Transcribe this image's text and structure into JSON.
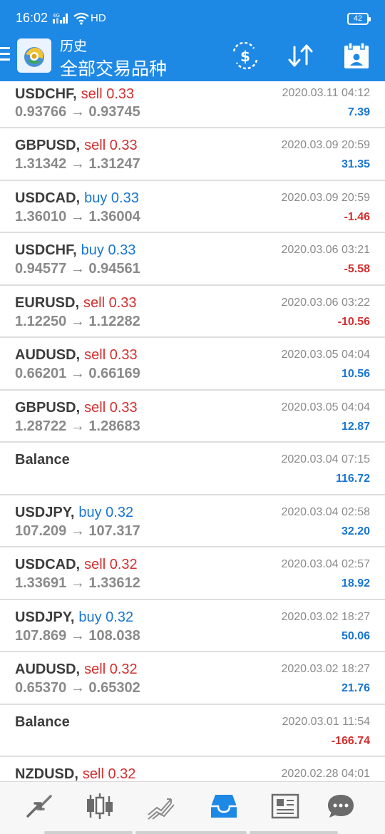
{
  "status_bar": {
    "time": "16:02",
    "network": "HD",
    "battery": "42"
  },
  "header": {
    "title_small": "历史",
    "title_large": "全部交易品种",
    "actions": [
      "currency-exchange-icon",
      "sort-icon",
      "calendar-icon"
    ]
  },
  "colors": {
    "header_bg": "#1e88e5",
    "sell": "#d32f2f",
    "buy": "#1976d2",
    "profit_positive": "#1976d2",
    "profit_negative": "#d32f2f"
  },
  "deals": [
    {
      "symbol": "USDCHF,",
      "direction": "sell",
      "volume": "sell 0.33",
      "prices": "0.93766 → 0.93745",
      "datetime": "2020.03.11 04:12",
      "profit": "7.39",
      "sign": "pos"
    },
    {
      "symbol": "GBPUSD,",
      "direction": "sell",
      "volume": "sell 0.33",
      "prices": "1.31342 → 1.31247",
      "datetime": "2020.03.09 20:59",
      "profit": "31.35",
      "sign": "pos"
    },
    {
      "symbol": "USDCAD,",
      "direction": "buy",
      "volume": "buy 0.33",
      "prices": "1.36010 → 1.36004",
      "datetime": "2020.03.09 20:59",
      "profit": "-1.46",
      "sign": "neg"
    },
    {
      "symbol": "USDCHF,",
      "direction": "buy",
      "volume": "buy 0.33",
      "prices": "0.94577 → 0.94561",
      "datetime": "2020.03.06 03:21",
      "profit": "-5.58",
      "sign": "neg"
    },
    {
      "symbol": "EURUSD,",
      "direction": "sell",
      "volume": "sell 0.33",
      "prices": "1.12250 → 1.12282",
      "datetime": "2020.03.06 03:22",
      "profit": "-10.56",
      "sign": "neg"
    },
    {
      "symbol": "AUDUSD,",
      "direction": "sell",
      "volume": "sell 0.33",
      "prices": "0.66201 → 0.66169",
      "datetime": "2020.03.05 04:04",
      "profit": "10.56",
      "sign": "pos"
    },
    {
      "symbol": "GBPUSD,",
      "direction": "sell",
      "volume": "sell 0.33",
      "prices": "1.28722 → 1.28683",
      "datetime": "2020.03.05 04:04",
      "profit": "12.87",
      "sign": "pos"
    },
    {
      "symbol": "Balance",
      "direction": "",
      "volume": "",
      "prices": "",
      "datetime": "2020.03.04 07:15",
      "profit": "116.72",
      "sign": "pos"
    },
    {
      "symbol": "USDJPY,",
      "direction": "buy",
      "volume": "buy 0.32",
      "prices": "107.209 → 107.317",
      "datetime": "2020.03.04 02:58",
      "profit": "32.20",
      "sign": "pos"
    },
    {
      "symbol": "USDCAD,",
      "direction": "sell",
      "volume": "sell 0.32",
      "prices": "1.33691 → 1.33612",
      "datetime": "2020.03.04 02:57",
      "profit": "18.92",
      "sign": "pos"
    },
    {
      "symbol": "USDJPY,",
      "direction": "buy",
      "volume": "buy 0.32",
      "prices": "107.869 → 108.038",
      "datetime": "2020.03.02 18:27",
      "profit": "50.06",
      "sign": "pos"
    },
    {
      "symbol": "AUDUSD,",
      "direction": "sell",
      "volume": "sell 0.32",
      "prices": "0.65370 → 0.65302",
      "datetime": "2020.03.02 18:27",
      "profit": "21.76",
      "sign": "pos"
    },
    {
      "symbol": "Balance",
      "direction": "",
      "volume": "",
      "prices": "",
      "datetime": "2020.03.01 11:54",
      "profit": "-166.74",
      "sign": "neg"
    },
    {
      "symbol": "NZDUSD,",
      "direction": "sell",
      "volume": "sell 0.32",
      "prices": "",
      "datetime": "2020.02.28 04:01",
      "profit": "",
      "sign": "pos"
    }
  ],
  "bottom_nav": {
    "items": [
      "quotes-icon",
      "chart-icon",
      "trade-icon",
      "history-icon",
      "news-icon",
      "chat-icon"
    ],
    "active": "history-icon",
    "active_color": "#1e88e5"
  }
}
